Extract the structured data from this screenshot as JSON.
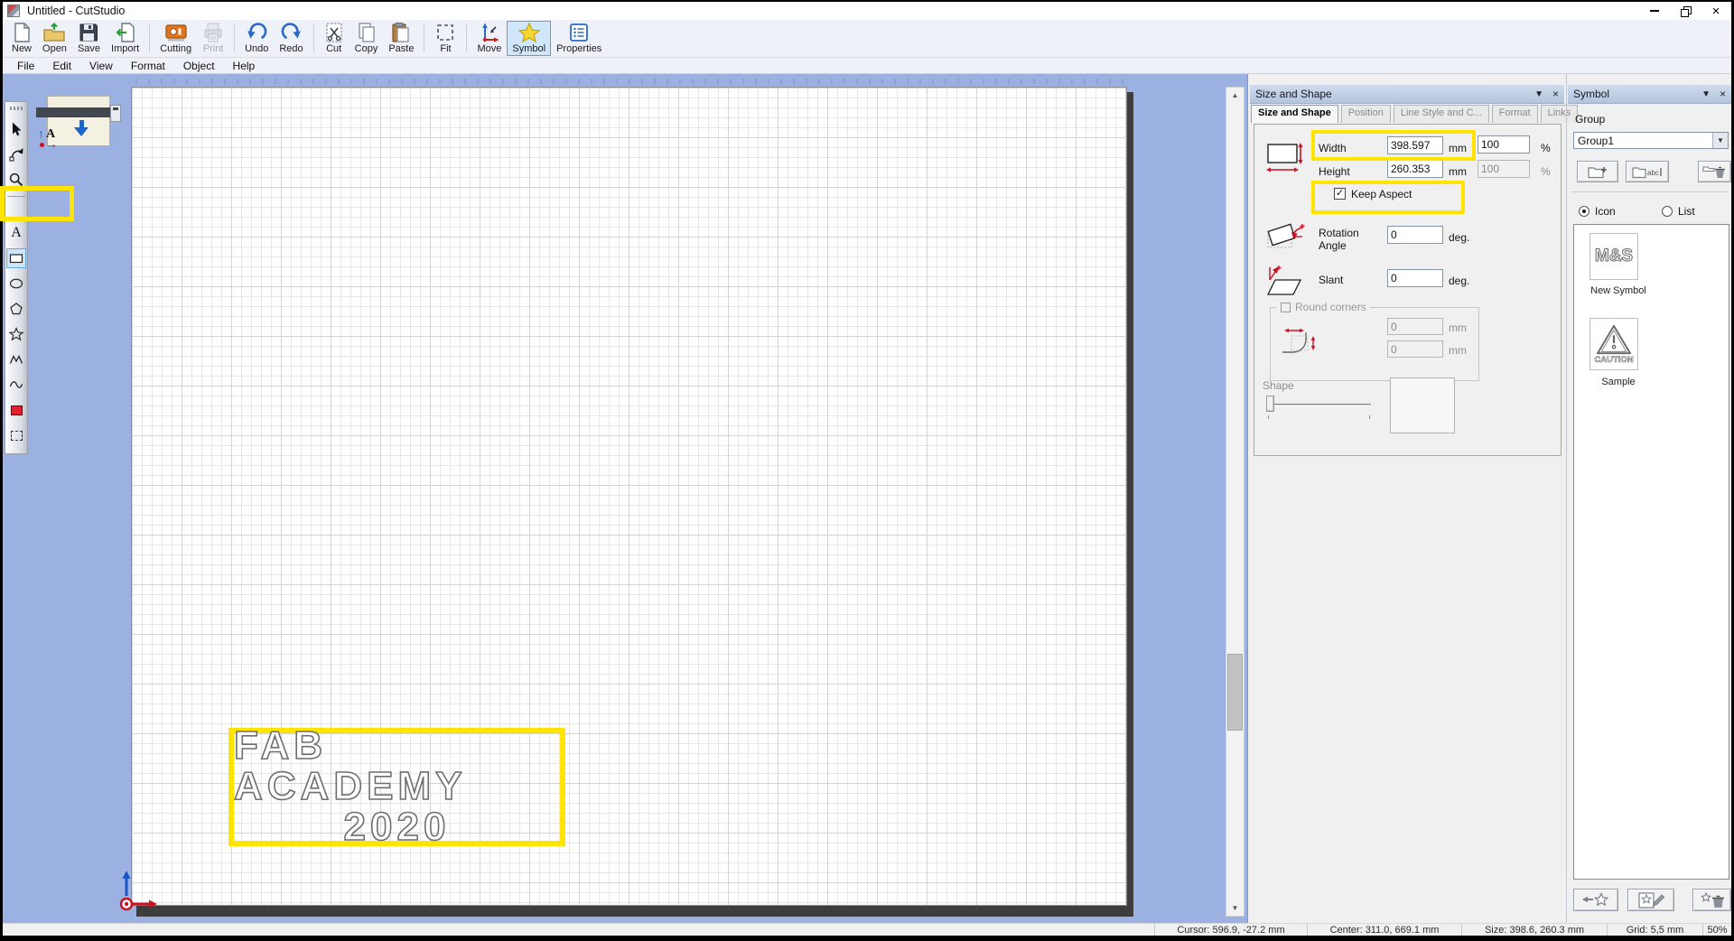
{
  "window": {
    "title": "Untitled - CutStudio"
  },
  "icons": {
    "close": "×",
    "dropdown": "▼",
    "panel_collapse": "▼",
    "panel_close": "×",
    "scroll_up": "▲",
    "scroll_down": "▼",
    "check": "✓"
  },
  "menu": {
    "items": [
      "File",
      "Edit",
      "View",
      "Format",
      "Object",
      "Help"
    ]
  },
  "toolbar": {
    "buttons": [
      {
        "name": "new",
        "label": "New"
      },
      {
        "name": "open",
        "label": "Open"
      },
      {
        "name": "save",
        "label": "Save"
      },
      {
        "name": "import",
        "label": "Import"
      },
      {
        "name": "cutting",
        "label": "Cutting"
      },
      {
        "name": "print",
        "label": "Print",
        "state": "disabled"
      },
      {
        "name": "undo",
        "label": "Undo"
      },
      {
        "name": "redo",
        "label": "Redo"
      },
      {
        "name": "cut",
        "label": "Cut"
      },
      {
        "name": "copy",
        "label": "Copy"
      },
      {
        "name": "paste",
        "label": "Paste"
      },
      {
        "name": "fit",
        "label": "Fit"
      },
      {
        "name": "move",
        "label": "Move"
      },
      {
        "name": "symbol",
        "label": "Symbol",
        "state": "active"
      },
      {
        "name": "properties",
        "label": "Properties"
      }
    ]
  },
  "tools": [
    "select",
    "node-edit",
    "zoom",
    "text",
    "rectangle",
    "ellipse",
    "polygon",
    "star",
    "polyline",
    "curve",
    "fill-color",
    "select-area"
  ],
  "canvas": {
    "artwork_line1": "FAB ACADEMY",
    "artwork_line2": "2020"
  },
  "size_shape_panel": {
    "title": "Size and Shape",
    "tabs": [
      "Size and Shape",
      "Position",
      "Line Style and C...",
      "Format",
      "Links"
    ],
    "width_label": "Width",
    "width_value": "398.597",
    "width_percent": "100",
    "height_label": "Height",
    "height_value": "260.353",
    "height_percent": "100",
    "mm_unit": "mm",
    "percent_unit": "%",
    "keep_aspect_label": "Keep Aspect",
    "rotation_label_1": "Rotation",
    "rotation_label_2": "Angle",
    "rotation_value": "0",
    "slant_label": "Slant",
    "slant_value": "0",
    "deg_unit": "deg.",
    "round_corners_label": "Round corners",
    "round_corner_h": "0",
    "round_corner_v": "0",
    "shape_label": "Shape"
  },
  "symbol_panel": {
    "title": "Symbol",
    "group_label": "Group",
    "group_value": "Group1",
    "view_icon_label": "Icon",
    "view_list_label": "List",
    "items": [
      {
        "glyph": "M&S",
        "label": "New Symbol"
      },
      {
        "glyph": "CAUTION",
        "label": "Sample"
      }
    ]
  },
  "statusbar": {
    "cursor": "Cursor: 596.9, -27.2 mm",
    "center": "Center: 311.0, 669.1 mm",
    "size": "Size: 398.6, 260.3 mm",
    "grid": "Grid: 5,5 mm",
    "zoom": "50%"
  },
  "colors": {
    "workspace": "#9ab1e1",
    "highlight": "#ffe400",
    "accent_blue": "#2a6bc8",
    "accent_red": "#cc2222"
  }
}
